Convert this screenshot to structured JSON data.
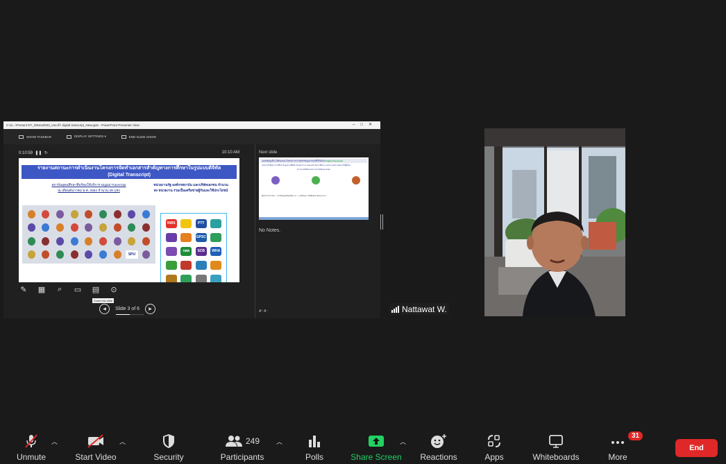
{
  "shared_window": {
    "title": "C:\\u\\...\\Present DT_29Nov2022_แนะนำ digital transcript_New.pptx - PowerPoint Presenter View",
    "toolbar": [
      "SHOW TASKBAR",
      "DISPLAY SETTINGS ▾",
      "END SLIDE SHOW"
    ],
    "timer": "0:10:59",
    "clock": "10:10 AM",
    "slide": {
      "title_line1": "รายงานสถานะการดำเนินงานโครงการจัดทำเอกสารสำคัญทางการศึกษาในรูปแบบดิจิทัล",
      "title_line2": "(Digital Transcript)",
      "left_caption_1": "สถาบันอุดมศึกษาที่พร้อมให้บริการ Digital Transcript",
      "left_caption_2": "ณ เดือนธันวาคม พ.ศ. 2564 จำนวน 39 แห่ง",
      "right_caption_1": "หน่วยงานรัฐ องค์กรสถาบัน และบริษัทเอกชน จำนวน",
      "right_caption_2": "80 หน่วยงาน ร่วมเป็นเครือข่ายผู้รับและใช้ประโยชน์",
      "logos_right": [
        "NWS",
        "",
        "PTT",
        "",
        "",
        "",
        "GPSC",
        "",
        "",
        "กสค",
        "SCB",
        "WHA",
        "",
        "",
        "",
        "",
        "",
        "",
        "",
        ""
      ],
      "logo_spu": "SPU"
    },
    "tooltip": "Zoom into slide",
    "slide_nav": "Slide 3 of 6",
    "slide_progress": 0.5,
    "next_label": "Next slide",
    "next_slide": {
      "bar_text": "แหล่งข้อมูลที่จะได้รับผลประโยชน์จากการจัดทำข้อมูลร่วมกันที่ใช้ได้จริง",
      "bar_highlight": "Digital Transcript",
      "text": "เอกสารสำคัญทางการศึกษาในรูปแบบดิจิทัล ช่วยลดภาระงานของสถาบันการศึกษา และอำนวยความสะดวกให้ผู้เรียน",
      "caption": "ความร่วมมือกับหน่วยงานภาครัฐและเอกชน",
      "lines": "ผู้เรียน 5.4 ล้านคน — เข้าถึงข้อมูลได้ทุกที่ทุกเวลา — ลดต้นทุนการจัดพิมพ์และจัดส่งเอกสาร"
    },
    "notes": "No Notes.",
    "font_btns": "A⁺  A⁻"
  },
  "participant": {
    "name": "Nattawat W."
  },
  "toolbar": {
    "unmute": "Unmute",
    "start_video": "Start Video",
    "security": "Security",
    "participants": "Participants",
    "participants_count": "249",
    "polls": "Polls",
    "share_screen": "Share Screen",
    "reactions": "Reactions",
    "apps": "Apps",
    "whiteboards": "Whiteboards",
    "more": "More",
    "more_badge": "31",
    "end": "End"
  },
  "colors": {
    "background": "#1a1a1a",
    "share_green": "#22d163",
    "end_red": "#e02828",
    "muted_red": "#e02828"
  }
}
